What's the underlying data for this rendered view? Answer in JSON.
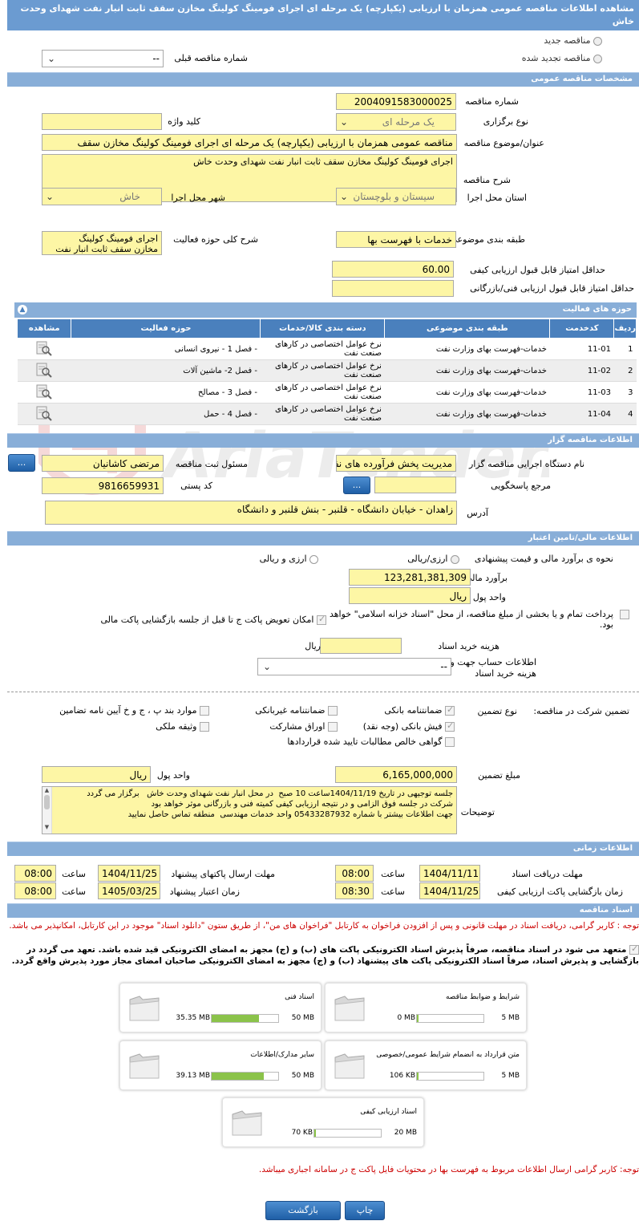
{
  "page_title": "مشاهده اطلاعات مناقصه عمومی همزمان با ارزیابی (یکپارچه) یک مرحله ای اجرای فومینگ کولینگ مخازن سقف ثابت انبار نفت شهدای وحدت خاش",
  "top": {
    "new": "مناقصه جدید",
    "renewed": "مناقصه تجدید شده",
    "prev_label": "شماره مناقصه قبلی",
    "prev_value": "--"
  },
  "general": {
    "header": "مشخصات مناقصه عمومی",
    "number_label": "شماره مناقصه",
    "number": "2004091583000025",
    "keyword_label": "کلید واژه",
    "keyword": "",
    "stage_label": "نوع برگزاری",
    "stage": "یک مرحله ای",
    "subject_label": "عنوان/موضوع مناقصه",
    "subject": "مناقصه عمومی همزمان با ارزیابی (یکپارچه) یک مرحله ای اجرای فومینگ کولینگ مخازن سقف",
    "desc_label": "شرح مناقصه",
    "desc": "اجرای فومینگ کولینگ مخازن سقف ثابت انبار نفت شهدای وحدت خاش",
    "province_label": "استان محل اجرا",
    "province": "سیستان و بلوچستان",
    "city_label": "شهر محل اجرا",
    "city": "خاش",
    "category_label": "طبقه بندی موضوعی",
    "category": "خدمات با فهرست بها",
    "scope_label": "شرح کلی حوزه فعالیت",
    "scope": "اجرای فومینگ کولینگ مخازن سقف ثابت انبار نفت",
    "minq_label": "حداقل امتیاز قابل قبول ارزیابی کیفی",
    "minq": "60.00",
    "mint_label": "حداقل امتیاز قابل قبول ارزیابی فنی/بازرگانی",
    "mint": ""
  },
  "activity": {
    "header": "حوزه های فعالیت",
    "cols": [
      "ردیف",
      "کدخدمت",
      "طبقه بندی موضوعی",
      "دسته بندی کالا/خدمات",
      "حوزه فعالیت",
      "مشاهده"
    ],
    "rows": [
      {
        "n": "1",
        "code": "11-01",
        "cat": "خدمات-فهرست بهای وزارت نفت",
        "group": "نرخ عوامل اختصاصی در کارهای صنعت نفت",
        "area": "- فصل 1 - نیروی انسانی"
      },
      {
        "n": "2",
        "code": "11-02",
        "cat": "خدمات-فهرست بهای وزارت نفت",
        "group": "نرخ عوامل اختصاصی در کارهای صنعت نفت",
        "area": "- فصل 2- ماشین آلات"
      },
      {
        "n": "3",
        "code": "11-03",
        "cat": "خدمات-فهرست بهای وزارت نفت",
        "group": "نرخ عوامل اختصاصی در کارهای صنعت نفت",
        "area": "- فصل 3 - مصالح"
      },
      {
        "n": "4",
        "code": "11-04",
        "cat": "خدمات-فهرست بهای وزارت نفت",
        "group": "نرخ عوامل اختصاصی در کارهای صنعت نفت",
        "area": "- فصل 4 - حمل"
      }
    ]
  },
  "organizer": {
    "header": "اطلاعات مناقصه گزار",
    "org_label": "نام دستگاه اجرایی مناقصه گزار",
    "org": "مدیریت پخش فرآورده های نفتی",
    "resp_label": "مسئول ثبت مناقصه",
    "resp": "مرتضی کاشانیان",
    "ref_label": "مرجع پاسخگویی",
    "ref": "",
    "postal_label": "کد پستی",
    "postal": "9816659931",
    "addr_label": "آدرس",
    "addr": "زاهدان - خیابان دانشگاه - قلنبر - بنش قلنبر و دانشگاه",
    "btn": "..."
  },
  "finance": {
    "header": "اطلاعات مالی/تامین اعتبار",
    "estimate_type_label": "نحوه ی برآورد مالی و قیمت پیشنهادی",
    "opt1": "ارزی/ریالی",
    "opt2": "ارزی و ریالی",
    "estimate_label": "برآورد مالی",
    "estimate": "123,281,381,309",
    "unit_label": "واحد پول",
    "unit": "ریال",
    "treasury": "پرداخت تمام و یا بخشی از مبلغ مناقصه، از محل \"اسناد خزانه اسلامی\" خواهد بود.",
    "swap": "امکان تعویض پاکت ج تا قبل از جلسه بازگشایی پاکت مالی",
    "doc_cost_label": "هزینه خرید اسناد",
    "doc_cost_unit": "ریال",
    "account_label": "اطلاعات حساب جهت واریز هزینه خرید اسناد",
    "account": "--"
  },
  "guarantee": {
    "participation_label": "تضمین شرکت در مناقصه:",
    "type_label": "نوع تضمین",
    "opts": [
      "ضمانتنامه بانکی",
      "ضمانتنامه غیربانکی",
      "موارد بند پ ، ج و خ آیین نامه تضامین",
      "فیش بانکی (وجه نقد)",
      "اوراق مشارکت",
      "وثیقه ملکی",
      "گواهی خالص مطالبات تایید شده قراردادها"
    ],
    "amount_label": "مبلغ تضمین",
    "amount": "6,165,000,000",
    "unit_label": "واحد پول",
    "unit": "ریال",
    "notes_label": "توضیحات",
    "notes": "جلسه توجیهی در تاریخ 1404/11/19ساعت 10 صبح  در محل انبار نفت شهدای وحدت خاش   برگزار می گردد\nشرکت در جلسه فوق الزامی و در نتیجه ارزیابی کیفی کمیته فنی و بازرگانی موثر خواهد بود\nجهت اطلاعات بیشتر با شماره 05433287932 واحد خدمات مهندسی  منطقه تماس حاصل نمایید"
  },
  "timing": {
    "header": "اطلاعات زمانی",
    "recv_label": "مهلت دریافت اسناد",
    "recv_date": "1404/11/11",
    "recv_time": "08:00",
    "send_label": "مهلت ارسال پاکتهای پیشنهاد",
    "send_date": "1404/11/25",
    "send_time": "08:00",
    "open_label": "زمان بازگشایی پاکت ارزیابی کیفی",
    "open_date": "1404/11/25",
    "open_time": "08:30",
    "valid_label": "زمان اعتبار پیشنهاد",
    "valid_date": "1405/03/25",
    "valid_time": "08:00",
    "time_label": "ساعت"
  },
  "docs": {
    "header": "اسناد مناقصه",
    "note": "توجه : کاربر گرامی، دریافت اسناد در مهلت قانونی و پس از افزودن فراخوان به کارتابل \"فراخوان های من\"، از طریق ستون \"دانلود اسناد\" موجود در این کارتابل، امکانپذیر می باشد.",
    "commit": "متعهد می شود در اسناد مناقصه، صرفاً پذیرش اسناد الکترونیکی پاکت های (ب) و (ج) مجهز به امضای الکترونیکی قید شده باشد. تعهد می گردد در بازگشایی و پذیرش اسناد، صرفاً اسناد الکترونیکی پاکت های پیشنهاد (ب) و (ج) مجهز به امضای الکترونیکی صاحبان امضای مجاز مورد پذیرش واقع گردد.",
    "files": [
      {
        "name": "شرایط و ضوابط مناقصه",
        "max": "5 MB",
        "cur": "0 MB",
        "pct": 0
      },
      {
        "name": "اسناد فنی",
        "max": "50 MB",
        "cur": "35.35 MB",
        "pct": 0.71
      },
      {
        "name": "متن قرارداد به انضمام شرایط عمومی/خصوصی",
        "max": "5 MB",
        "cur": "106 KB",
        "pct": 0.02
      },
      {
        "name": "سایر مدارک/اطلاعات",
        "max": "50 MB",
        "cur": "39.13 MB",
        "pct": 0.78
      },
      {
        "name": "اسناد ارزیابی کیفی",
        "max": "20 MB",
        "cur": "70 KB",
        "pct": 0.01
      }
    ],
    "bottom_note": "توجه: کاربر گرامی ارسال اطلاعات مربوط به فهرست بها در محتویات فایل پاکت ج در سامانه اجباری میباشد."
  },
  "buttons": {
    "print": "چاپ",
    "back": "بازگشت"
  },
  "colors": {
    "header": "#88aed8",
    "field": "#fdf6a5",
    "table_head": "#4a80bd",
    "red": "#cc0000",
    "progress": "#8bc34a"
  }
}
